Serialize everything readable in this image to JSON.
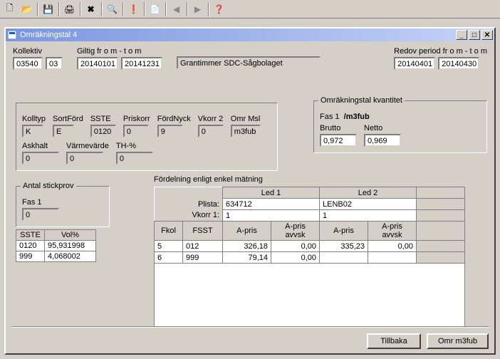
{
  "toolbar": {
    "new": "🗋",
    "open": "📂",
    "save": "💾",
    "print": "🖨",
    "delete": "✖",
    "find": "🔍",
    "warn": "❗",
    "copy": "📄",
    "prev": "◀",
    "next": "▶",
    "help": "❓"
  },
  "window": {
    "title": "Omräkningstal 4"
  },
  "header": {
    "kollektiv_label": "Kollektiv",
    "kollektiv1": "03540",
    "kollektiv2": "03",
    "giltig_label": "Giltig fr o m - t o m",
    "giltig_from": "20140101",
    "giltig_to": "20141231",
    "desc": "Grantimmer SDC-Sågbolaget",
    "redov_label": "Redov period  fr o m - t o m",
    "redov_from": "20140401",
    "redov_to": "20140430"
  },
  "params": {
    "kolltyp_label": "Kolltyp",
    "kolltyp": "K",
    "sortford_label": "SortFörd",
    "sortford": "E",
    "sste_label": "SSTE",
    "sste": "0120",
    "priskorr_label": "Priskorr",
    "priskorr": "0",
    "fordnyck_label": "FördNyck",
    "fordnyck": "9",
    "vkorr2_label": "Vkorr 2",
    "vkorr2": "0",
    "omrmsl_label": "Omr Msl",
    "omrmsl": "m3fub",
    "askhalt_label": "Askhalt",
    "askhalt": "0",
    "varmev_label": "Värmevärde",
    "varmev": "0",
    "th_label": "TH-%",
    "th": "0"
  },
  "omr_kvant": {
    "group_title": "Omräkningstal kvantitet",
    "fas_label": "Fas 1",
    "fas_unit": "/m3fub",
    "brutto_label": "Brutto",
    "brutto": "0,972",
    "netto_label": "Netto",
    "netto": "0,969"
  },
  "stickprov": {
    "group_title": "Antal stickprov",
    "fas1_label": "Fas 1",
    "fas1": "0"
  },
  "sste_table": {
    "col1": "SSTE",
    "col2": "Vol%",
    "rows": [
      {
        "sste": "0120",
        "vol": "95,931998"
      },
      {
        "sste": "999",
        "vol": "4,068002"
      }
    ]
  },
  "dist": {
    "title": "Fördelning enligt enkel mätning",
    "led1": "Led 1",
    "led2": "Led 2",
    "plista_label": "Plista:",
    "plista1": "634712",
    "plista2": "LENB02",
    "vkorr1_label": "Vkorr 1:",
    "vkorr1_1": "1",
    "vkorr1_2": "1",
    "fkol_h": "Fkol",
    "fsst_h": "FSST",
    "apris_h": "A-pris",
    "apris_avvsk_h": "A-pris avvsk",
    "rows": [
      {
        "fkol": "5",
        "fsst": "012",
        "ap1": "326,18",
        "av1": "0,00",
        "ap2": "335,23",
        "av2": "0,00"
      },
      {
        "fkol": "6",
        "fsst": "999",
        "ap1": "79,14",
        "av1": "0,00",
        "ap2": "",
        "av2": ""
      }
    ]
  },
  "footer": {
    "tillbaka": "Tillbaka",
    "omr": "Omr m3fub"
  }
}
